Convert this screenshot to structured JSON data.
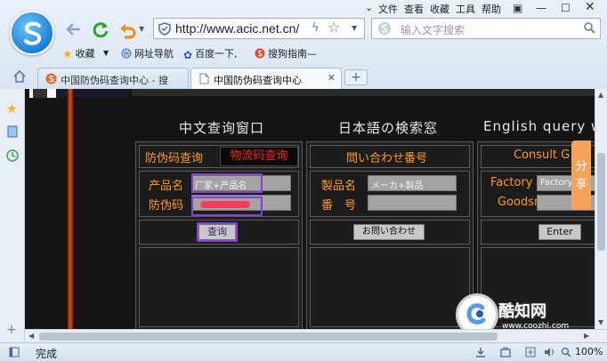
{
  "browser": {
    "menu": [
      "文件",
      "查看",
      "收藏",
      "工具",
      "帮助"
    ],
    "url": "http://www.acic.net.cn/",
    "search_placeholder": "输入文字搜索",
    "favorites": {
      "label": "收藏",
      "items": [
        "网址导航",
        "百度一下,",
        "搜狗指南—"
      ]
    },
    "tabs": [
      {
        "label": "中国防伪码查询中心 - 搜",
        "active": false
      },
      {
        "label": "中国防伪码查询中心",
        "active": true
      }
    ],
    "new_tab": "+"
  },
  "page": {
    "panels": [
      {
        "title": "中文查询窗口",
        "tab_active": "防伪码查询",
        "tab_other": "物流码查询",
        "field1_label": "产品名",
        "field1_value": "厂家+产品名",
        "field2_label": "防伪码",
        "button": "查询"
      },
      {
        "title": "日本語の検索窓",
        "header": "問い合わせ番号",
        "field1_label": "製品名",
        "field1_value": "メーカ+製品",
        "field2_label": "番　号",
        "button": "お問い合わせ"
      },
      {
        "title": "English query w",
        "header": "Consult G",
        "field1_label": "Factory",
        "field1_value": "Factory",
        "field2_label": "Goodsn",
        "button": "Enter"
      }
    ],
    "share": [
      "分",
      "享"
    ]
  },
  "watermark": {
    "name": "酷知网",
    "domain": "www.coozhi.com"
  },
  "status": {
    "text": "完成",
    "zoom": "100%"
  }
}
